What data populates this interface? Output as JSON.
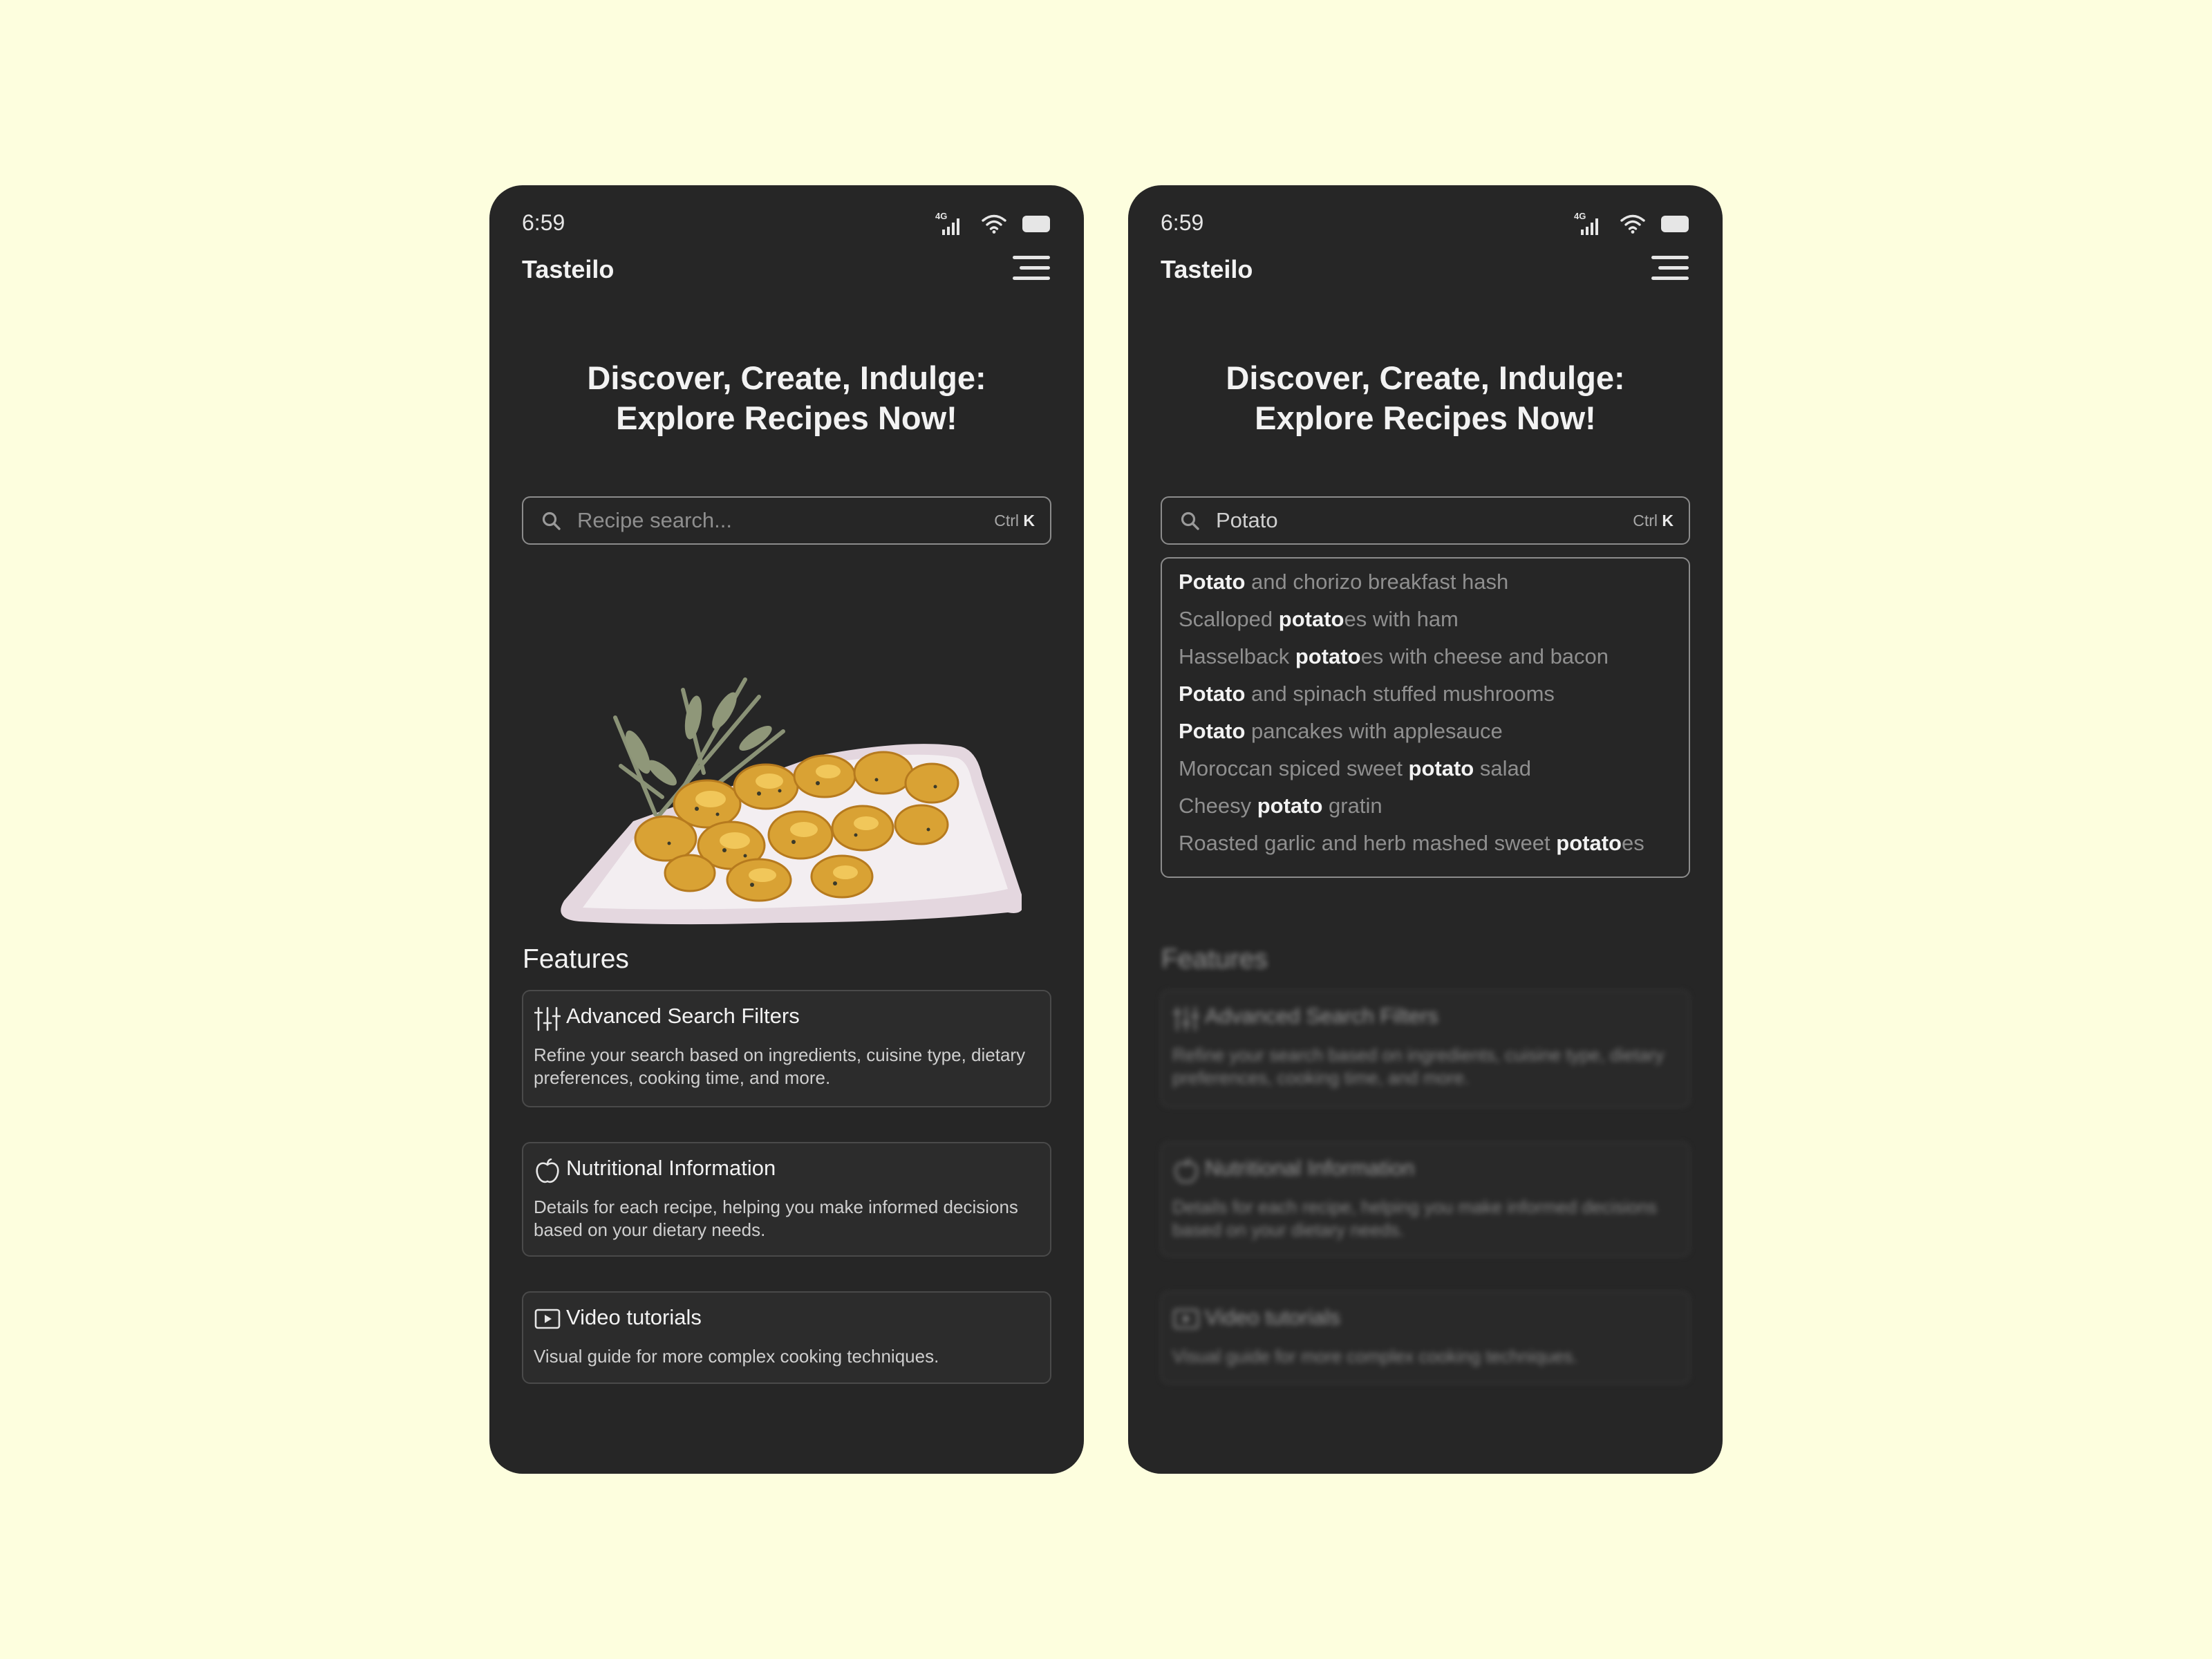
{
  "colors": {
    "page_background": "#fdfede",
    "phone_background": "#262626",
    "text_primary": "#f2f2f2",
    "text_muted": "#8f8f8f"
  },
  "screens": [
    {
      "status": {
        "time": "6:59",
        "network": "4G"
      },
      "app_title": "Tasteilo",
      "hero": {
        "line1": "Discover, Create, Indulge:",
        "line2": "Explore Recipes Now!"
      },
      "search": {
        "placeholder": "Recipe search...",
        "value": "",
        "shortcut_mod": "Ctrl",
        "shortcut_key": "K"
      },
      "features": {
        "heading": "Features",
        "items": [
          {
            "icon": "sliders-icon",
            "title": "Advanced Search Filters",
            "description": "Refine your search based on ingredients, cuisine type, dietary preferences, cooking time, and more."
          },
          {
            "icon": "apple-icon",
            "title": "Nutritional Information",
            "description": "Details for each recipe, helping you make informed decisions based on your dietary needs."
          },
          {
            "icon": "video-play-icon",
            "title": "Video tutorials",
            "description": "Visual guide for more complex cooking techniques."
          }
        ]
      }
    },
    {
      "status": {
        "time": "6:59",
        "network": "4G"
      },
      "app_title": "Tasteilo",
      "hero": {
        "line1": "Discover, Create, Indulge:",
        "line2": "Explore Recipes Now!"
      },
      "search": {
        "placeholder": "Recipe search...",
        "value": "Potato",
        "shortcut_mod": "Ctrl",
        "shortcut_key": "K"
      },
      "suggestions": [
        {
          "before": "",
          "match": "Potato",
          "after": " and chorizo breakfast hash"
        },
        {
          "before": "Scalloped ",
          "match": "potato",
          "after": "es with ham"
        },
        {
          "before": "Hasselback ",
          "match": "potato",
          "after": "es with cheese and bacon"
        },
        {
          "before": "",
          "match": "Potato",
          "after": " and spinach stuffed mushrooms"
        },
        {
          "before": "",
          "match": "Potato",
          "after": " pancakes with applesauce"
        },
        {
          "before": "Moroccan spiced sweet ",
          "match": "potato",
          "after": " salad"
        },
        {
          "before": "Cheesy ",
          "match": "potato",
          "after": " gratin"
        },
        {
          "before": "Roasted garlic and herb mashed sweet ",
          "match": "potato",
          "after": "es"
        }
      ],
      "features": {
        "heading": "Features",
        "items": [
          {
            "icon": "sliders-icon",
            "title": "Advanced Search Filters",
            "description": "Refine your search based on ingredients, cuisine type, dietary preferences, cooking time, and more."
          },
          {
            "icon": "apple-icon",
            "title": "Nutritional Information",
            "description": "Details for each recipe, helping you make informed decisions based on your dietary needs."
          },
          {
            "icon": "video-play-icon",
            "title": "Video tutorials",
            "description": "Visual guide for more complex cooking techniques."
          }
        ]
      }
    }
  ]
}
